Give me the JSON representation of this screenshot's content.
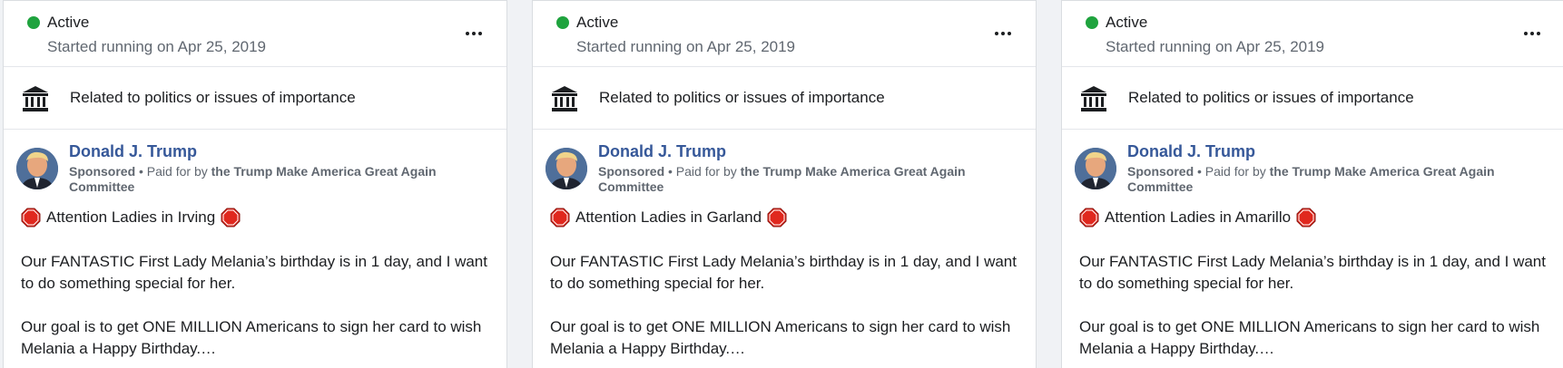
{
  "cards": [
    {
      "status": {
        "label": "Active",
        "started": "Started running on Apr 25, 2019"
      },
      "category": {
        "label": "Related to politics or issues of importance",
        "icon": "institution-icon"
      },
      "ad": {
        "page_name": "Donald J. Trump",
        "sponsored": "Sponsored",
        "paid_prefix": " • Paid for by ",
        "funder": "the Trump Make America Great Again Committee",
        "headline": "Attention Ladies in Irving",
        "paragraph1": "Our FANTASTIC First Lady Melania’s birthday is in 1 day, and I want to do something special for her.",
        "paragraph2": "Our goal is to get ONE MILLION Americans to sign her card to wish Melania a Happy Birthday.…"
      }
    },
    {
      "status": {
        "label": "Active",
        "started": "Started running on Apr 25, 2019"
      },
      "category": {
        "label": "Related to politics or issues of importance",
        "icon": "institution-icon"
      },
      "ad": {
        "page_name": "Donald J. Trump",
        "sponsored": "Sponsored",
        "paid_prefix": " • Paid for by ",
        "funder": "the Trump Make America Great Again Committee",
        "headline": "Attention Ladies in Garland",
        "paragraph1": "Our FANTASTIC First Lady Melania’s birthday is in 1 day, and I want to do something special for her.",
        "paragraph2": "Our goal is to get ONE MILLION Americans to sign her card to wish Melania a Happy Birthday.…"
      }
    },
    {
      "status": {
        "label": "Active",
        "started": "Started running on Apr 25, 2019"
      },
      "category": {
        "label": "Related to politics or issues of importance",
        "icon": "institution-icon"
      },
      "ad": {
        "page_name": "Donald J. Trump",
        "sponsored": "Sponsored",
        "paid_prefix": " • Paid for by ",
        "funder": "the Trump Make America Great Again Committee",
        "headline": "Attention Ladies in Amarillo",
        "paragraph1": "Our FANTASTIC First Lady Melania’s birthday is in 1 day, and I want to do something special for her.",
        "paragraph2": "Our goal is to get ONE MILLION Americans to sign her card to wish Melania a Happy Birthday.…"
      }
    }
  ],
  "colors": {
    "active_dot": "#1fa33e",
    "page_name": "#365899",
    "stop_sign": "#e0281e"
  }
}
